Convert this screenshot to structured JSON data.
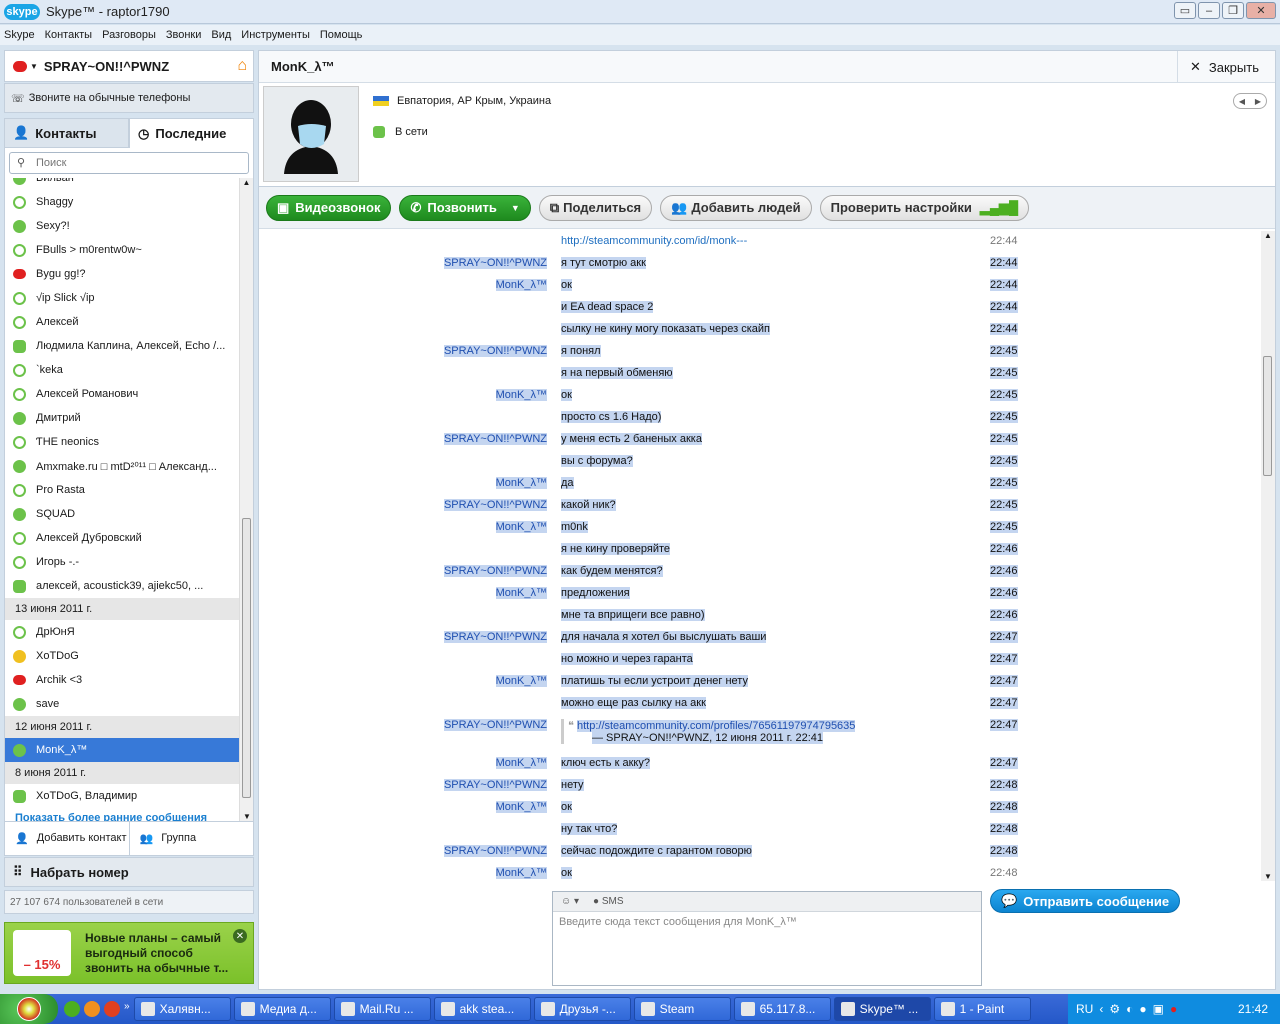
{
  "window": {
    "logo": "skype",
    "title": "Skype™ - raptor1790"
  },
  "menu": [
    "Skype",
    "Контакты",
    "Разговоры",
    "Звонки",
    "Вид",
    "Инструменты",
    "Помощь"
  ],
  "left": {
    "profile_name": "SPRAY~ON!!^PWNZ",
    "phone_line": "Звоните на обычные телефоны",
    "tab_contacts": "Контакты",
    "tab_recent": "Последние",
    "search_placeholder": "Поиск",
    "contacts": [
      {
        "name": "Вилван",
        "status": "online"
      },
      {
        "name": "Shaggy",
        "status": "offline"
      },
      {
        "name": "Sexy?!",
        "status": "online"
      },
      {
        "name": "FBulls > m0rentw0w~",
        "status": "offline"
      },
      {
        "name": "Bygu gg!?",
        "status": "busy"
      },
      {
        "name": "√ip Slick √ip",
        "status": "offline"
      },
      {
        "name": "Алексей",
        "status": "offline"
      },
      {
        "name": "Людмила Каплина, Алексей, Echo /...",
        "status": "group"
      },
      {
        "name": "`keka",
        "status": "offline"
      },
      {
        "name": "Алексей Романович",
        "status": "offline"
      },
      {
        "name": "Дмитрий",
        "status": "online"
      },
      {
        "name": "ƬHE      neonics",
        "status": "offline"
      },
      {
        "name": "Amxmake.ru □ mtD²⁰¹¹ □ Александ...",
        "status": "online"
      },
      {
        "name": "Pro Rasta",
        "status": "offline"
      },
      {
        "name": "SQUAD",
        "status": "online"
      },
      {
        "name": "Алексей Дубровский",
        "status": "offline"
      },
      {
        "name": "Игорь                  -.-",
        "status": "offline"
      },
      {
        "name": "алексей, acoustick39, ajiekc50, ...",
        "status": "group"
      }
    ],
    "date1": "13 июня 2011 г.",
    "contacts2": [
      {
        "name": "ДрЮнЯ",
        "status": "offline"
      },
      {
        "name": "XoTDoG",
        "status": "away"
      },
      {
        "name": "Archik <3",
        "status": "busy"
      },
      {
        "name": "save",
        "status": "online"
      }
    ],
    "date2": "12 июня 2011 г.",
    "selected": "MonK_λ™",
    "date3": "8 июня 2011 г.",
    "contacts3": [
      {
        "name": "XoTDoG, Владимир",
        "status": "group"
      }
    ],
    "show_more": "Показать более ранние сообщения",
    "add_contact": "Добавить контакт",
    "group": "Группа",
    "dial": "Набрать номер",
    "users_online": "27 107 674 пользователей в сети",
    "promo_badge": "– 15%",
    "promo_text": "Новые планы – самый выгодный способ звонить на обычные т..."
  },
  "chat": {
    "name": "MonK_λ™",
    "close": "Закрыть",
    "location": "Евпатория, АР Крым, Украина",
    "status": "В сети",
    "btn_video": "Видеозвонок",
    "btn_call": "Позвонить",
    "btn_share": "Поделиться",
    "btn_add": "Добавить людей",
    "btn_check": "Проверить настройки",
    "messages": [
      {
        "who": "",
        "text": "http://steamcommunity.com/id/monk---",
        "time": "22:44",
        "link": true,
        "sel": false
      },
      {
        "who": "SPRAY~ON!!^PWNZ",
        "text": "я тут смотрю акк",
        "time": "22:44"
      },
      {
        "who": "MonK_λ™",
        "text": "ок",
        "time": "22:44"
      },
      {
        "who": "",
        "text": "и EA dead space 2",
        "time": "22:44"
      },
      {
        "who": "",
        "text": "сылку не кину могу показать через скайп",
        "time": "22:44"
      },
      {
        "who": "SPRAY~ON!!^PWNZ",
        "text": "я понял",
        "time": "22:45"
      },
      {
        "who": "",
        "text": "я на первый обменяю",
        "time": "22:45"
      },
      {
        "who": "MonK_λ™",
        "text": "ок",
        "time": "22:45"
      },
      {
        "who": "",
        "text": "просто cs 1.6 Надо)",
        "time": "22:45"
      },
      {
        "who": "SPRAY~ON!!^PWNZ",
        "text": "у меня есть 2 баненых акка",
        "time": "22:45"
      },
      {
        "who": "",
        "text": "вы с форума?",
        "time": "22:45"
      },
      {
        "who": "MonK_λ™",
        "text": "да",
        "time": "22:45"
      },
      {
        "who": "SPRAY~ON!!^PWNZ",
        "text": "какой ник?",
        "time": "22:45"
      },
      {
        "who": "MonK_λ™",
        "text": "m0nk",
        "time": "22:45"
      },
      {
        "who": "",
        "text": "я не кину проверяйте",
        "time": "22:46"
      },
      {
        "who": "SPRAY~ON!!^PWNZ",
        "text": " как будем менятся?",
        "time": "22:46"
      },
      {
        "who": "MonK_λ™",
        "text": "предложения",
        "time": "22:46"
      },
      {
        "who": "",
        "text": "мне та вприщеги все равно)",
        "time": "22:46"
      },
      {
        "who": "SPRAY~ON!!^PWNZ",
        "text": "для начала я хотел бы выслушать ваши",
        "time": "22:47"
      },
      {
        "who": "",
        "text": "но можно и через гаранта",
        "time": "22:47"
      },
      {
        "who": "MonK_λ™",
        "text": "платишь ты если устроит денег нету",
        "time": "22:47"
      },
      {
        "who": "",
        "text": "можно еще раз сылку на акк",
        "time": "22:47"
      },
      {
        "who": "SPRAY~ON!!^PWNZ",
        "text": "http://steamcommunity.com/profiles/76561197974795635",
        "quote_meta": "— SPRAY~ON!!^PWNZ, 12 июня 2011 г. 22:41",
        "time": "22:47",
        "quote": true
      },
      {
        "who": "MonK_λ™",
        "text": "ключ есть к акку?",
        "time": "22:47"
      },
      {
        "who": "SPRAY~ON!!^PWNZ",
        "text": "нету",
        "time": "22:48"
      },
      {
        "who": "MonK_λ™",
        "text": "ок",
        "time": "22:48"
      },
      {
        "who": "",
        "text": "ну так что?",
        "time": "22:48"
      },
      {
        "who": "SPRAY~ON!!^PWNZ",
        "text": "сейчас подождите с гарантом говорю",
        "time": "22:48"
      },
      {
        "who": "MonK_λ™",
        "text": "ок",
        "time": "22:48",
        "sel": false
      }
    ],
    "sms": "SMS",
    "compose_placeholder": "Введите сюда текст сообщения для MonK_λ™",
    "send": "Отправить сообщение"
  },
  "taskbar": {
    "items": [
      "Халявн...",
      "Медиа д...",
      "Mail.Ru ...",
      "akk stea...",
      "Друзья -...",
      "Steam",
      "65.117.8...",
      "Skype™ ...",
      "1 - Paint"
    ],
    "lang": "RU",
    "clock": "21:42"
  }
}
